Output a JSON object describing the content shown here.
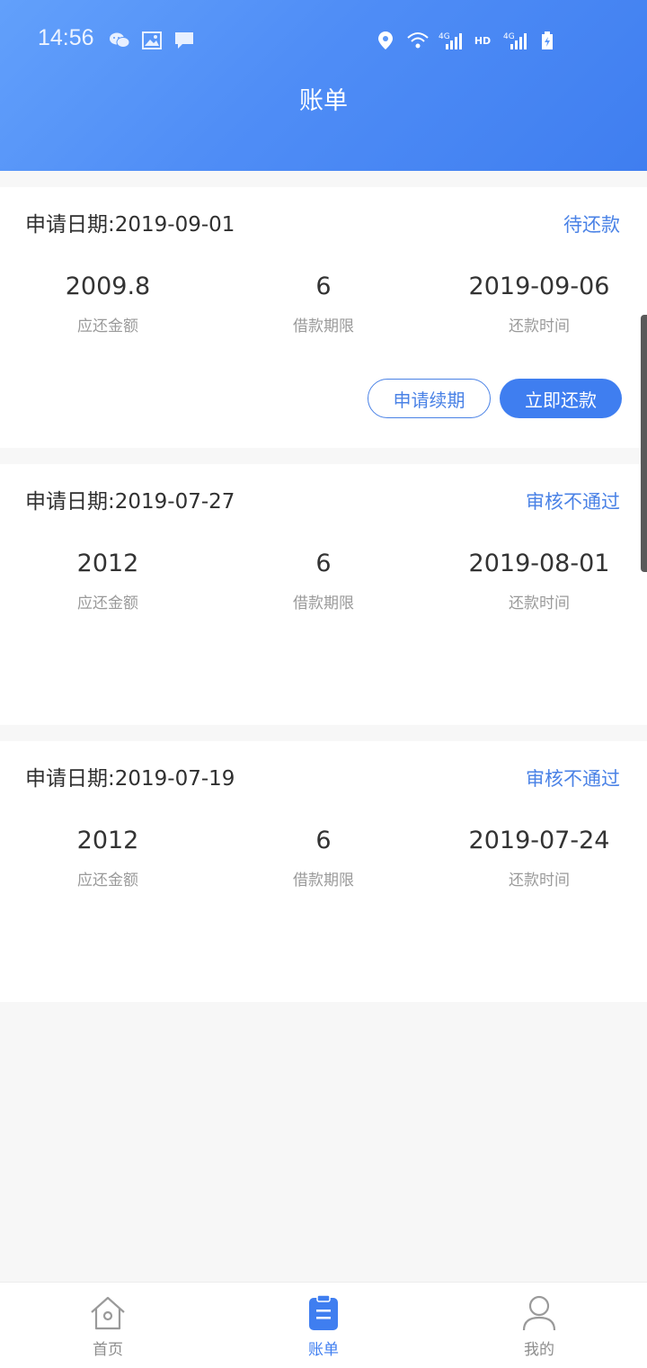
{
  "status_bar": {
    "time": "14:56",
    "icons_left": [
      "wechat-icon",
      "image-icon",
      "message-icon"
    ],
    "icons_right": [
      "location-icon",
      "wifi-icon",
      "signal-4g-icon",
      "hd-icon",
      "signal-4g-icon",
      "battery-charging-icon"
    ],
    "hd_text": "HD"
  },
  "header": {
    "title": "账单"
  },
  "bills": [
    {
      "apply_date": "申请日期:2019-09-01",
      "status": "待还款",
      "amount": "2009.8",
      "amount_label": "应还金额",
      "term": "6",
      "term_label": "借款期限",
      "repay_time": "2019-09-06",
      "repay_time_label": "还款时间",
      "renew_label": "申请续期",
      "repay_label": "立即还款"
    },
    {
      "apply_date": "申请日期:2019-07-27",
      "status": "审核不通过",
      "amount": "2012",
      "amount_label": "应还金额",
      "term": "6",
      "term_label": "借款期限",
      "repay_time": "2019-08-01",
      "repay_time_label": "还款时间"
    },
    {
      "apply_date": "申请日期:2019-07-19",
      "status": "审核不通过",
      "amount": "2012",
      "amount_label": "应还金额",
      "term": "6",
      "term_label": "借款期限",
      "repay_time": "2019-07-24",
      "repay_time_label": "还款时间"
    }
  ],
  "tabbar": [
    {
      "label": "首页",
      "icon": "home-icon",
      "active": false
    },
    {
      "label": "账单",
      "icon": "bill-icon",
      "active": true
    },
    {
      "label": "我的",
      "icon": "user-icon",
      "active": false
    }
  ],
  "colors": {
    "accent": "#3f7ef0",
    "status_text": "#4a82e6",
    "header_gradient_start": "#62a0fb",
    "header_gradient_end": "#3f7ef0"
  }
}
